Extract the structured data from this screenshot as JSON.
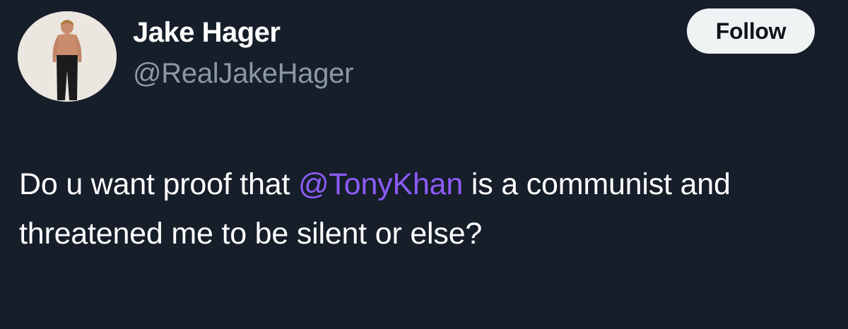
{
  "user": {
    "display_name": "Jake Hager",
    "handle": "@RealJakeHager",
    "avatar_icon": "profile-photo"
  },
  "follow_button": {
    "label": "Follow"
  },
  "tweet": {
    "text_before": "Do u want proof that ",
    "mention": "@TonyKhan",
    "text_after": " is a communist and threatened me to be silent or else?"
  },
  "colors": {
    "background": "#161e2a",
    "mention": "#8c5cf6",
    "handle": "#8b98a5",
    "button_bg": "#eff3f4"
  }
}
